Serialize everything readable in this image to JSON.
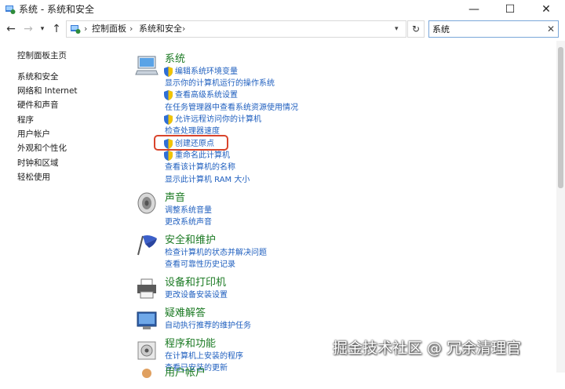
{
  "window": {
    "title": "系统 - 系统和安全"
  },
  "nav": {
    "breadcrumb": [
      "控制面板",
      "系统和安全"
    ],
    "search_value": "系统"
  },
  "sidebar": {
    "home": "控制面板主页",
    "items": [
      "系统和安全",
      "网络和 Internet",
      "硬件和声音",
      "程序",
      "用户帐户",
      "外观和个性化",
      "时钟和区域",
      "轻松使用"
    ]
  },
  "categories": [
    {
      "title": "系统",
      "tasks": [
        "编辑系统环境变量",
        "显示你的计算机运行的操作系统",
        "查看高级系统设置",
        "在任务管理器中查看系统资源使用情况",
        "允许远程访问你的计算机",
        "检查处理器速度",
        "创建还原点",
        "重命名此计算机",
        "查看该计算机的名称",
        "显示此计算机 RAM 大小"
      ]
    },
    {
      "title": "声音",
      "tasks": [
        "调整系统音量",
        "更改系统声音"
      ]
    },
    {
      "title": "安全和维护",
      "tasks": [
        "检查计算机的状态并解决问题",
        "查看可靠性历史记录"
      ]
    },
    {
      "title": "设备和打印机",
      "tasks": [
        "更改设备安装设置"
      ]
    },
    {
      "title": "疑难解答",
      "tasks": [
        "自动执行推荐的维护任务"
      ]
    },
    {
      "title": "程序和功能",
      "tasks": [
        "在计算机上安装的程序",
        "查看已安装的更新"
      ]
    },
    {
      "title": "用户帐户",
      "tasks": []
    }
  ],
  "highlight_color": "#d9442c",
  "watermark": "掘金技术社区 @ 冗余清理官"
}
